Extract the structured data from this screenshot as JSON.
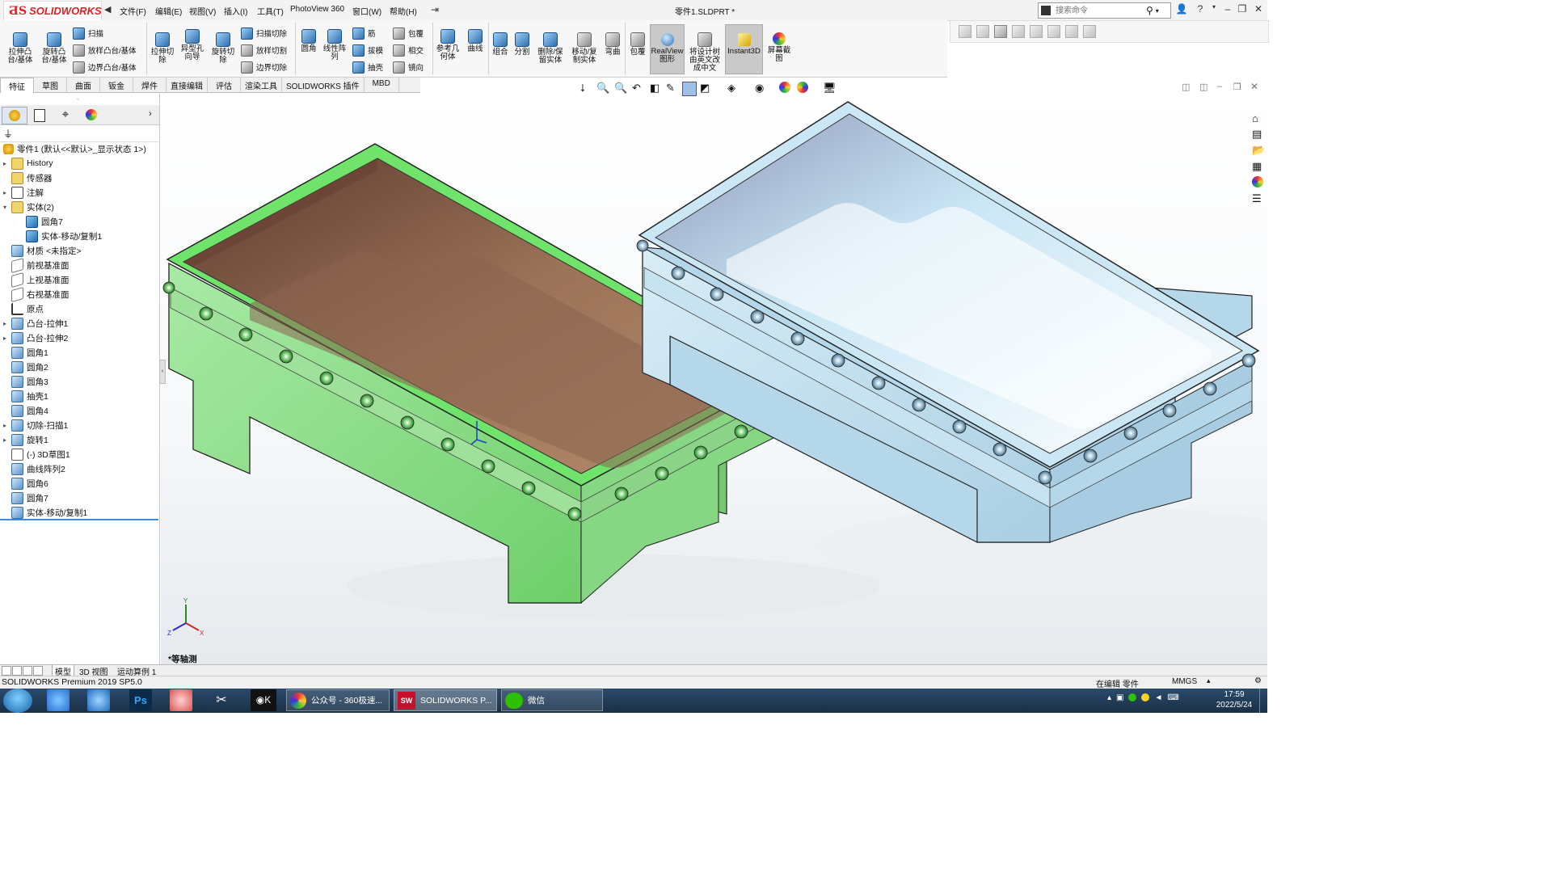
{
  "app": {
    "logo_ds": "ƋS",
    "logo_text": "SOLIDWORKS",
    "document_title": "零件1.SLDPRT *",
    "menus": [
      "文件(F)",
      "编辑(E)",
      "视图(V)",
      "插入(I)",
      "工具(T)",
      "PhotoView 360",
      "窗口(W)",
      "帮助(H)"
    ],
    "search_placeholder": "搜索命令"
  },
  "ribbon": {
    "buttons": {
      "extrude_boss": "拉伸凸台/基体",
      "revolve_boss": "旋转凸台/基体",
      "sweep": "扫描",
      "loft_boss": "放样凸台/基体",
      "boundary_boss": "边界凸台/基体",
      "extrude_cut": "拉伸切除",
      "hole_wizard": "异型孔向导",
      "revolve_cut": "旋转切除",
      "sweep_cut": "扫描切除",
      "loft_cut": "放样切割",
      "boundary_cut": "边界切除",
      "fillet": "圆角",
      "linear_pattern": "线性阵列",
      "rib": "筋",
      "draft": "拔模",
      "shell": "抽壳",
      "wrap": "包覆",
      "intersect": "相交",
      "mirror": "镜向",
      "ref_geometry": "参考几何体",
      "curves": "曲线",
      "combine": "组合",
      "split": "分割",
      "delete_keep_body": "删除/保留实体",
      "move_copy_body": "移动/复制实体",
      "flex": "弯曲",
      "wrap2": "包覆",
      "realview": "RealView图形",
      "translate_tree": "将设计树由英文改成中文",
      "instant3d": "Instant3D",
      "screen_capture": "屏幕截图"
    },
    "tabs": [
      "特征",
      "草图",
      "曲面",
      "钣金",
      "焊件",
      "直接编辑",
      "评估",
      "渲染工具",
      "SOLIDWORKS 插件",
      "MBD"
    ],
    "active_tab": "特征"
  },
  "feature_tree": {
    "root": "零件1  (默认<<默认>_显示状态 1>)",
    "items": [
      {
        "label": "History",
        "icon": "history-folder-icon",
        "expand": true,
        "indent": 0
      },
      {
        "label": "传感器",
        "icon": "sensor-icon",
        "expand": false,
        "indent": 0
      },
      {
        "label": "注解",
        "icon": "annotation-icon",
        "expand": true,
        "indent": 0
      },
      {
        "label": "实体(2)",
        "icon": "solid-bodies-icon",
        "expand": true,
        "expanded": true,
        "indent": 0
      },
      {
        "label": "圆角7",
        "icon": "solid-body-icon",
        "expand": false,
        "indent": 1
      },
      {
        "label": "实体-移动/复制1",
        "icon": "solid-body-icon",
        "expand": false,
        "indent": 1
      },
      {
        "label": "材质 <未指定>",
        "icon": "material-icon",
        "expand": false,
        "indent": 0
      },
      {
        "label": "前视基准面",
        "icon": "plane-icon",
        "expand": false,
        "indent": 0
      },
      {
        "label": "上视基准面",
        "icon": "plane-icon",
        "expand": false,
        "indent": 0
      },
      {
        "label": "右视基准面",
        "icon": "plane-icon",
        "expand": false,
        "indent": 0
      },
      {
        "label": "原点",
        "icon": "origin-icon",
        "expand": false,
        "indent": 0
      },
      {
        "label": "凸台-拉伸1",
        "icon": "extrude-icon",
        "expand": true,
        "indent": 0
      },
      {
        "label": "凸台-拉伸2",
        "icon": "extrude-icon",
        "expand": true,
        "indent": 0
      },
      {
        "label": "圆角1",
        "icon": "fillet-icon",
        "expand": false,
        "indent": 0
      },
      {
        "label": "圆角2",
        "icon": "fillet-icon",
        "expand": false,
        "indent": 0
      },
      {
        "label": "圆角3",
        "icon": "fillet-icon",
        "expand": false,
        "indent": 0
      },
      {
        "label": "抽壳1",
        "icon": "shell-icon",
        "expand": false,
        "indent": 0
      },
      {
        "label": "圆角4",
        "icon": "fillet-icon",
        "expand": false,
        "indent": 0
      },
      {
        "label": "切除-扫描1",
        "icon": "sweep-cut-icon",
        "expand": true,
        "indent": 0
      },
      {
        "label": "旋转1",
        "icon": "revolve-icon",
        "expand": true,
        "indent": 0
      },
      {
        "label": "(-) 3D草图1",
        "icon": "3d-sketch-icon",
        "expand": false,
        "indent": 0
      },
      {
        "label": "曲线阵列2",
        "icon": "curve-pattern-icon",
        "expand": false,
        "indent": 0
      },
      {
        "label": "圆角6",
        "icon": "fillet-icon",
        "expand": false,
        "indent": 0
      },
      {
        "label": "圆角7",
        "icon": "fillet-icon",
        "expand": false,
        "indent": 0
      },
      {
        "label": "实体-移动/复制1",
        "icon": "move-copy-icon",
        "expand": false,
        "indent": 0
      }
    ]
  },
  "viewport": {
    "view_label": "*等轴测",
    "left_model_color": "#8fdc8c",
    "left_model_rim": "#6fe36a",
    "right_model_color": "#bcd9ea"
  },
  "bottom_tabs": [
    "模型",
    "3D 视图",
    "运动算例 1"
  ],
  "status": {
    "left": "SOLIDWORKS Premium 2019 SP5.0",
    "editing": "在编辑 零件",
    "units": "MMGS"
  },
  "taskbar": {
    "windows": [
      {
        "label": "公众号 - 360极速...",
        "icon": "browser-icon"
      },
      {
        "label": "SOLIDWORKS P...",
        "icon": "solidworks-icon"
      },
      {
        "label": "微信",
        "icon": "wechat-icon"
      }
    ],
    "time": "17:59",
    "date": "2022/5/24"
  }
}
